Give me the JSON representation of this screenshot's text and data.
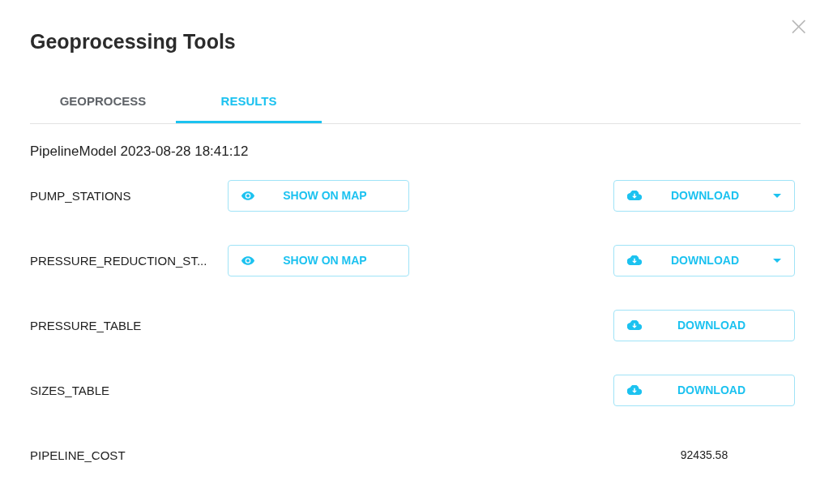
{
  "dialog": {
    "title": "Geoprocessing Tools",
    "close": "×"
  },
  "tabs": [
    {
      "label": "GEOPROCESS",
      "selected": false
    },
    {
      "label": "RESULTS",
      "selected": true
    }
  ],
  "result_title": "PipelineModel 2023-08-28 18:41:12",
  "rows": [
    {
      "kind": "layer",
      "name": "PUMP_STATIONS",
      "show_label": "SHOW ON MAP",
      "download_label": "DOWNLOAD",
      "dropdown": true
    },
    {
      "kind": "layer",
      "name": "PRESSURE_REDUCTION_ST...",
      "show_label": "SHOW ON MAP",
      "download_label": "DOWNLOAD",
      "dropdown": true
    },
    {
      "kind": "table",
      "name": "PRESSURE_TABLE",
      "download_label": "DOWNLOAD",
      "dropdown": false
    },
    {
      "kind": "table",
      "name": "SIZES_TABLE",
      "download_label": "DOWNLOAD",
      "dropdown": false
    },
    {
      "kind": "value",
      "name": "PIPELINE_COST",
      "value": "92435.58"
    }
  ]
}
